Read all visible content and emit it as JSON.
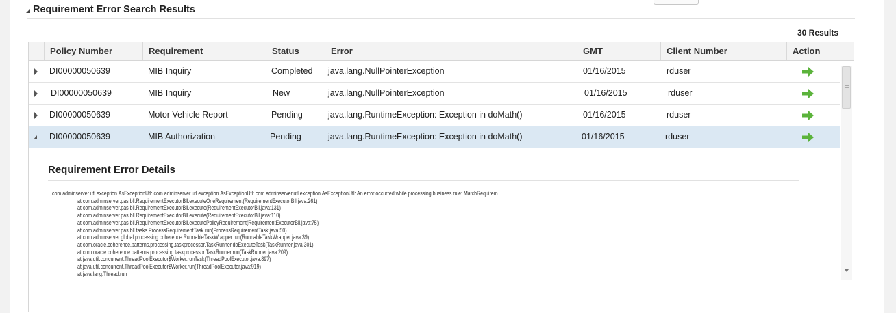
{
  "section": {
    "title": "Requirement Error Search Results"
  },
  "results": {
    "count_label": "30 Results"
  },
  "table": {
    "columns": [
      "Policy Number",
      "Requirement",
      "Status",
      "Error",
      "GMT",
      "Client Number",
      "Action"
    ],
    "rows": [
      {
        "policy": "DI00000050639",
        "requirement": "MIB Inquiry",
        "status": "Completed",
        "error": "java.lang.NullPointerException",
        "gmt": "01/16/2015",
        "client": "rduser",
        "expanded": false,
        "selected": false
      },
      {
        "policy": "DI00000050639",
        "requirement": "MIB Inquiry",
        "status": "New",
        "error": "java.lang.NullPointerException",
        "gmt": "01/16/2015",
        "client": "rduser",
        "expanded": false,
        "selected": false
      },
      {
        "policy": "DI00000050639",
        "requirement": "Motor Vehicle Report",
        "status": "Pending",
        "error": "java.lang.RuntimeException: Exception in doMath()",
        "gmt": "01/16/2015",
        "client": "rduser",
        "expanded": false,
        "selected": false
      },
      {
        "policy": "DI00000050639",
        "requirement": "MIB Authorization",
        "status": "Pending",
        "error": "java.lang.RuntimeException: Exception in doMath()",
        "gmt": "01/16/2015",
        "client": "rduser",
        "expanded": true,
        "selected": true
      }
    ]
  },
  "details": {
    "title": "Requirement Error Details",
    "stack_trace": [
      "com.adminserver.utl.exception.AsExceptionUtl: com.adminserver.utl.exception.AsExceptionUtl: com.adminserver.utl.exception.AsExceptionUtl: An error occurred while processing business rule: MatchRequirem",
      "at com.adminserver.pas.bll.RequirementExecutorBll.executeOneRequirement(RequirementExecutorBll.java:261)",
      "at com.adminserver.pas.bll.RequirementExecutorBll.execute(RequirementExecutorBll.java:131)",
      "at com.adminserver.pas.bll.RequirementExecutorBll.execute(RequirementExecutorBll.java:110)",
      "at com.adminserver.pas.bll.RequirementExecutorBll.executePolicyRequirement(RequirementExecutorBll.java:75)",
      "at com.adminserver.pas.bll.tasks.ProcessRequirementTask.run(ProcessRequirementTask.java:50)",
      "at com.adminserver.global.processing.coherence.RunnableTaskWrapper.run(RunnableTaskWrapper.java:39)",
      "at com.oracle.coherence.patterns.processing.taskprocessor.TaskRunner.doExecuteTask(TaskRunner.java:301)",
      "at com.oracle.coherence.patterns.processing.taskprocessor.TaskRunner.run(TaskRunner.java:209)",
      "at java.util.concurrent.ThreadPoolExecutor$Worker.runTask(ThreadPoolExecutor.java:897)",
      "at java.util.concurrent.ThreadPoolExecutor$Worker.run(ThreadPoolExecutor.java:919)",
      "at java.lang.Thread.run"
    ]
  },
  "icons": {
    "action": "green-right-arrow-icon",
    "expand": "triangle-right-icon",
    "collapse": "triangle-down-icon"
  },
  "colors": {
    "selected_row": "#dbe8f3",
    "action_arrow": "#5bb33b",
    "header_bg": "#f3f3f3"
  }
}
